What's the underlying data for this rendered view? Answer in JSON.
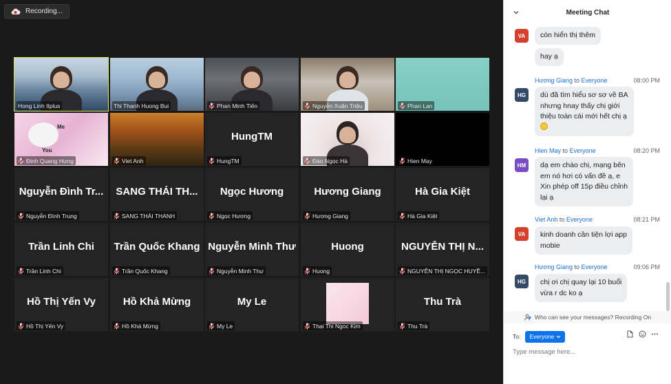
{
  "recording": {
    "label": "Recording..."
  },
  "gallery": {
    "tiles": [
      {
        "name": "Hong Linh Itplus",
        "big": ""
      },
      {
        "name": "Thi Thanh Huong Bui",
        "big": ""
      },
      {
        "name": "Phan Minh Tiến",
        "big": ""
      },
      {
        "name": "Nguyễn Xuân Triệu",
        "big": ""
      },
      {
        "name": "Phan Lan",
        "big": ""
      },
      {
        "name": "Đinh Quang Hưng",
        "big": ""
      },
      {
        "name": "Viet Anh",
        "big": ""
      },
      {
        "name": "HungTM",
        "big": "HungTM"
      },
      {
        "name": "Đào Ngọc Hà",
        "big": ""
      },
      {
        "name": "Hien May",
        "big": ""
      },
      {
        "name": "Nguyễn Đình Trung",
        "big": "Nguyễn Đình Tr..."
      },
      {
        "name": "SANG THÁI THANH",
        "big": "SANG THÁI TH..."
      },
      {
        "name": "Ngọc Hương",
        "big": "Ngọc Hương"
      },
      {
        "name": "Hương Giang",
        "big": "Hương Giang"
      },
      {
        "name": "Hà Gia Kiệt",
        "big": "Hà Gia Kiệt"
      },
      {
        "name": "Trần Linh Chi",
        "big": "Trần Linh Chi"
      },
      {
        "name": "Trần Quốc Khang",
        "big": "Trần Quốc Khang"
      },
      {
        "name": "Nguyễn Minh Thư",
        "big": "Nguyễn Minh Thư"
      },
      {
        "name": "Huong",
        "big": "Huong"
      },
      {
        "name": "NGUYỄN THỊ NGỌC HUYỀ...",
        "big": "NGUYỄN THỊ N..."
      },
      {
        "name": "Hồ Thị Yến Vy",
        "big": "Hồ Thị Yến Vy"
      },
      {
        "name": "Hồ Khả Mừng",
        "big": "Hồ Khả Mừng"
      },
      {
        "name": "My Le",
        "big": "My Le"
      },
      {
        "name": "Thai Thi Ngoc Kim",
        "big": ""
      },
      {
        "name": "Thu Trà",
        "big": "Thu Trà"
      }
    ],
    "sticker_text": {
      "me": "Me",
      "you": "You"
    }
  },
  "chat": {
    "title": "Meeting Chat",
    "to_word": "to",
    "messages": [
      {
        "initials": "VA",
        "color": "#d5402c",
        "sender": "",
        "recipient": "",
        "time": "",
        "lines": [
          "còn hiển thị thêm"
        ]
      },
      {
        "initials": "",
        "color": "",
        "sender": "",
        "recipient": "",
        "time": "",
        "lines": [
          "hay ạ"
        ]
      },
      {
        "initials": "HG",
        "color": "#344a66",
        "sender": "Hương Giang",
        "recipient": "Everyone",
        "time": "08:00 PM",
        "lines": [
          "dù đã tìm hiểu sơ sơ về BA",
          "nhưng hnay thấy chị giới",
          "thiệu toàn cái mới hết chị ạ"
        ]
      },
      {
        "initials": "HM",
        "color": "#7a4cc2",
        "sender": "Hien May",
        "recipient": "Everyone",
        "time": "08:20 PM",
        "lines": [
          "dạ em chào chị, mạng bên",
          "em nó hơi có vấn đề ạ, e",
          "Xin phép off 15p điều chỉnh",
          "lại ạ"
        ]
      },
      {
        "initials": "VA",
        "color": "#d5402c",
        "sender": "Viet Anh",
        "recipient": "Everyone",
        "time": "08:21 PM",
        "lines": [
          "kinh doanh cần tiện lợi app",
          "mobie"
        ]
      },
      {
        "initials": "HG",
        "color": "#344a66",
        "sender": "Hương Giang",
        "recipient": "Everyone",
        "time": "09:06 PM",
        "lines": [
          "chị ơi chị quay lại 10 buổi",
          "vừa r dc ko ạ"
        ]
      }
    ],
    "privacy_note": "Who can see your messages? Recording On",
    "to_label": "To:",
    "recipient_select": "Everyone",
    "input_placeholder": "Type message here..."
  },
  "icons": {
    "record": "cloud-record-icon",
    "mic": "mic-muted-icon",
    "collapse": "chevron-down-icon",
    "file": "file-icon",
    "emoji": "emoji-icon",
    "more": "more-icon",
    "people": "people-icon"
  }
}
